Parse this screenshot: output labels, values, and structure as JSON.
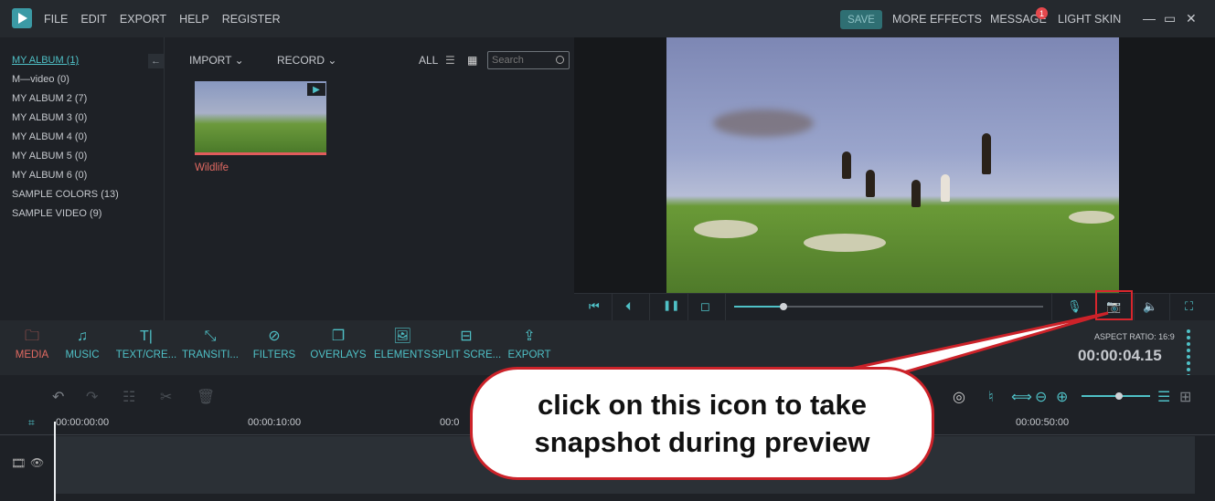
{
  "app": {
    "menu": [
      "FILE",
      "EDIT",
      "EXPORT",
      "HELP",
      "REGISTER"
    ],
    "save_label": "SAVE",
    "more_effects": "MORE EFFECTS",
    "message": "MESSAGE",
    "message_badge": "1",
    "light_skin": "LIGHT SKIN"
  },
  "albums": [
    {
      "label": "MY ALBUM (1)",
      "active": true
    },
    {
      "label": "M—video (0)"
    },
    {
      "label": "MY ALBUM 2 (7)"
    },
    {
      "label": "MY ALBUM 3 (0)"
    },
    {
      "label": "MY ALBUM 4 (0)"
    },
    {
      "label": "MY ALBUM 5 (0)"
    },
    {
      "label": "MY ALBUM 6 (0)"
    },
    {
      "label": "SAMPLE COLORS (13)"
    },
    {
      "label": "SAMPLE VIDEO (9)"
    }
  ],
  "library": {
    "import_label": "IMPORT",
    "record_label": "RECORD",
    "filter_label": "ALL",
    "search_placeholder": "Search",
    "clip_name": "Wildlife"
  },
  "player": {
    "progress": 0.16
  },
  "toolbar": {
    "items": [
      "MEDIA",
      "MUSIC",
      "TEXT/CRE...",
      "TRANSITI...",
      "FILTERS",
      "OVERLAYS",
      "ELEMENTS",
      "SPLIT SCRE...",
      "EXPORT"
    ],
    "aspect_ratio": "ASPECT RATIO: 16:9",
    "timecode": "00:00:04.15"
  },
  "timeline": {
    "ruler": [
      "00:00:00:00",
      "00:00:10:00",
      "00:0",
      "00:00:50:00"
    ],
    "zoom": 0.55
  },
  "callout": {
    "line1": "click on this icon to take",
    "line2": "snapshot during preview"
  },
  "colors": {
    "accent": "#4fc1c7",
    "active": "#e26a62",
    "highlight": "#d8262d"
  }
}
